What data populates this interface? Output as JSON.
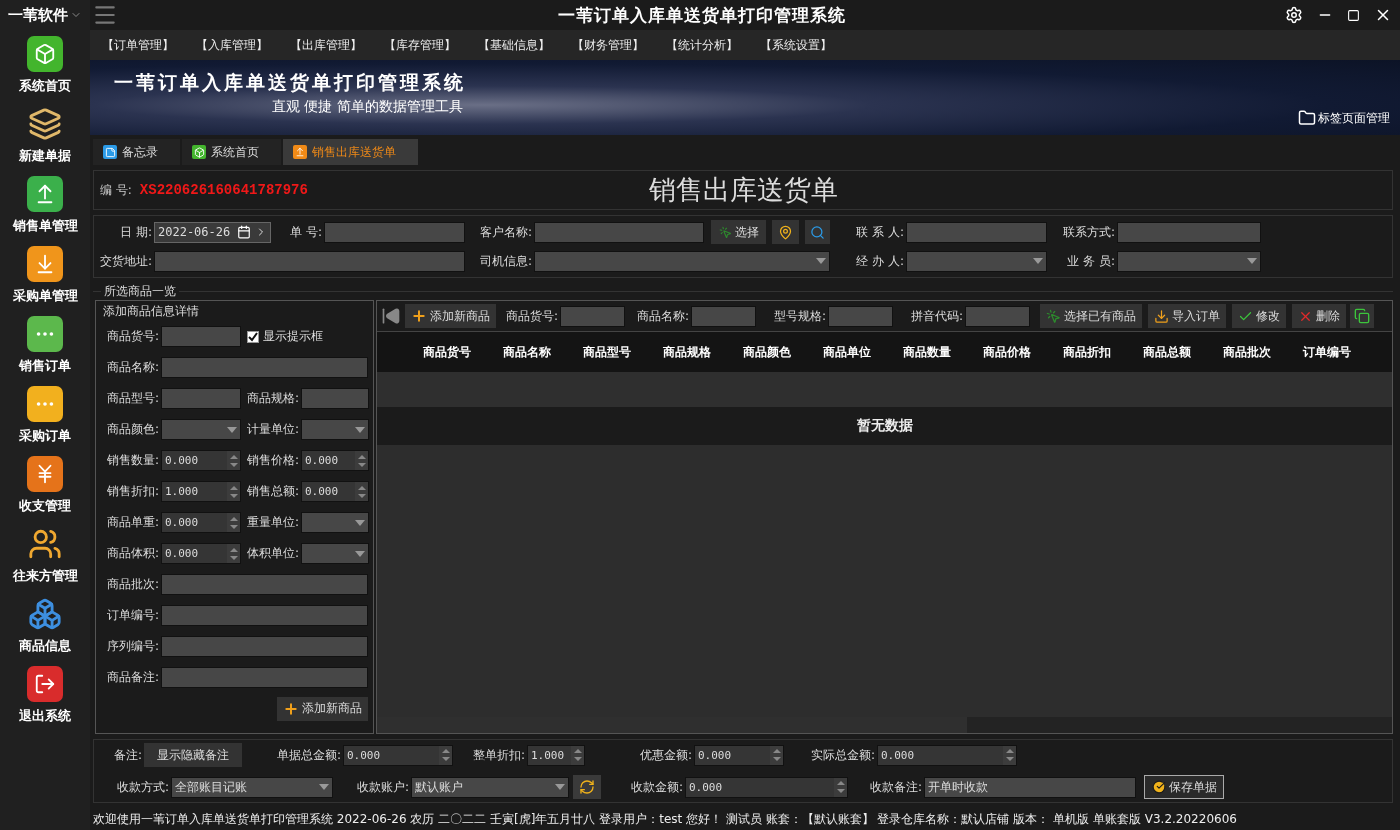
{
  "app": {
    "brand": "一苇软件",
    "title": "一苇订单入库单送货单打印管理系统"
  },
  "sidebar": [
    {
      "label": "系统首页"
    },
    {
      "label": "新建单据"
    },
    {
      "label": "销售单管理"
    },
    {
      "label": "采购单管理"
    },
    {
      "label": "销售订单"
    },
    {
      "label": "采购订单"
    },
    {
      "label": "收支管理"
    },
    {
      "label": "往来方管理"
    },
    {
      "label": "商品信息"
    },
    {
      "label": "退出系统"
    }
  ],
  "menu": [
    "【订单管理】",
    "【入库管理】",
    "【出库管理】",
    "【库存管理】",
    "【基础信息】",
    "【财务管理】",
    "【统计分析】",
    "【系统设置】"
  ],
  "banner": {
    "title": "一苇订单入库单送货单打印管理系统",
    "subtitle": "直观 便捷 简单的数据管理工具",
    "tab_manager": "标签页面管理"
  },
  "tabs": [
    {
      "label": "备忘录",
      "selected": false
    },
    {
      "label": "系统首页",
      "selected": false
    },
    {
      "label": "销售出库送货单",
      "selected": true
    }
  ],
  "form": {
    "number_label": "编 号:",
    "number": "XS220626160641787976",
    "title": "销售出库送货单"
  },
  "header_rows": [
    [
      {
        "kind": "date",
        "label": "日 期:",
        "value": "2022-06-26"
      },
      {
        "kind": "text",
        "label": "单 号:"
      },
      {
        "kind": "text",
        "label": "客户名称:"
      },
      {
        "kind": "button",
        "text": "选择"
      },
      {
        "kind": "icon_button"
      },
      {
        "kind": "icon_button"
      },
      {
        "kind": "text",
        "label": "联 系 人:"
      },
      {
        "kind": "text",
        "label": "联系方式:"
      }
    ],
    [
      {
        "kind": "text",
        "label": "交货地址:"
      },
      {
        "kind": "select",
        "label": "司机信息:"
      },
      {
        "kind": "select",
        "label": "经 办 人:"
      },
      {
        "kind": "select",
        "label": "业 务 员:"
      }
    ]
  ],
  "products": {
    "legend": "所选商品一览",
    "detail_title": "添加商品信息详情",
    "detail_rows": [
      [
        {
          "kind": "text",
          "label": "商品货号:"
        },
        {
          "kind": "checkbox",
          "label": "显示提示框",
          "checked": true
        }
      ],
      [
        {
          "kind": "text",
          "label": "商品名称:"
        }
      ],
      [
        {
          "kind": "text",
          "label": "商品型号:"
        },
        {
          "kind": "text",
          "label": "商品规格:"
        }
      ],
      [
        {
          "kind": "select",
          "label": "商品颜色:"
        },
        {
          "kind": "select",
          "label": "计量单位:"
        }
      ],
      [
        {
          "kind": "spin",
          "label": "销售数量:",
          "value": "0.000"
        },
        {
          "kind": "spin",
          "label": "销售价格:",
          "value": "0.000"
        }
      ],
      [
        {
          "kind": "spin",
          "label": "销售折扣:",
          "value": "1.000"
        },
        {
          "kind": "spin",
          "label": "销售总额:",
          "value": "0.000"
        }
      ],
      [
        {
          "kind": "spin",
          "label": "商品单重:",
          "value": "0.000"
        },
        {
          "kind": "select",
          "label": "重量单位:"
        }
      ],
      [
        {
          "kind": "spin",
          "label": "商品体积:",
          "value": "0.000"
        },
        {
          "kind": "select",
          "label": "体积单位:"
        }
      ],
      [
        {
          "kind": "text",
          "label": "商品批次:"
        }
      ],
      [
        {
          "kind": "text",
          "label": "订单编号:"
        }
      ],
      [
        {
          "kind": "text",
          "label": "序列编号:"
        }
      ],
      [
        {
          "kind": "text",
          "label": "商品备注:"
        }
      ]
    ],
    "detail_button": "添加新商品",
    "toolbar": {
      "add": "添加新商品",
      "filters": [
        "商品货号:",
        "商品名称:",
        "型号规格:",
        "拼音代码:"
      ],
      "buttons": [
        "选择已有商品",
        "导入订单",
        "修改",
        "删除"
      ]
    },
    "columns": [
      "商品货号",
      "商品名称",
      "商品型号",
      "商品规格",
      "商品颜色",
      "商品单位",
      "商品数量",
      "商品价格",
      "商品折扣",
      "商品总额",
      "商品批次",
      "订单编号"
    ],
    "empty": "暂无数据"
  },
  "footer_rows": [
    [
      {
        "kind": "button",
        "label": "备注:",
        "text": "显示隐藏备注"
      },
      {
        "kind": "spin",
        "label": "单据总金额:",
        "value": "0.000"
      },
      {
        "kind": "spin",
        "label": "整单折扣:",
        "value": "1.000"
      },
      {
        "kind": "spin",
        "label": "优惠金额:",
        "value": "0.000"
      },
      {
        "kind": "spin",
        "label": "实际总金额:",
        "value": "0.000"
      }
    ],
    [
      {
        "kind": "select",
        "label": "收款方式:",
        "value": "全部账目记账"
      },
      {
        "kind": "select",
        "label": "收款账户:",
        "value": "默认账户"
      },
      {
        "kind": "icon_button"
      },
      {
        "kind": "spin",
        "label": "收款金额:",
        "value": "0.000"
      },
      {
        "kind": "text",
        "label": "收款备注:",
        "value": "开单时收款"
      },
      {
        "kind": "save",
        "text": "保存单据"
      }
    ]
  ],
  "status_bar": "欢迎使用一苇订单入库单送货单打印管理系统 2022-06-26 农历 二〇二二 壬寅[虎]年五月廿八 登录用户：test 您好！ 测试员 账套：【默认账套】 登录仓库名称：默认店铺 版本： 单机版 单账套版 V3.2.20220606"
}
